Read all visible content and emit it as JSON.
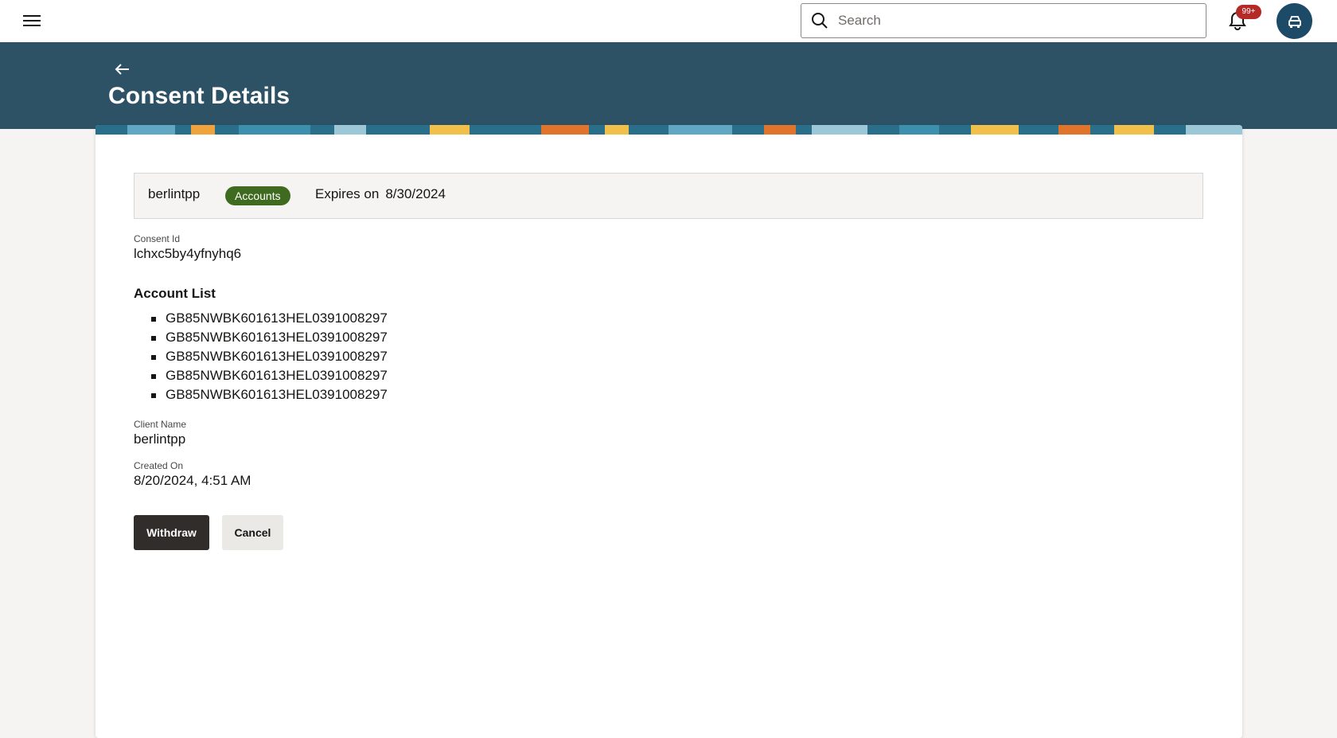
{
  "topbar": {
    "search_placeholder": "Search",
    "notification_count": "99+"
  },
  "header": {
    "title": "Consent Details"
  },
  "summary": {
    "client": "berlintpp",
    "type_badge": "Accounts",
    "expires_label": "Expires on",
    "expires_date": "8/30/2024"
  },
  "details": {
    "consent_id_label": "Consent Id",
    "consent_id_value": "lchxc5by4yfnyhq6",
    "account_list_title": "Account List",
    "accounts": [
      "GB85NWBK601613HEL0391008297",
      "GB85NWBK601613HEL0391008297",
      "GB85NWBK601613HEL0391008297",
      "GB85NWBK601613HEL0391008297",
      "GB85NWBK601613HEL0391008297"
    ],
    "client_name_label": "Client Name",
    "client_name_value": "berlintpp",
    "created_on_label": "Created On",
    "created_on_value": "8/20/2024, 4:51 AM"
  },
  "actions": {
    "withdraw_label": "Withdraw",
    "cancel_label": "Cancel"
  },
  "colors": {
    "header_band": "#2d5266",
    "avatar": "#1d4a66",
    "badge_green": "#3e6b1f",
    "notif_red": "#b52a26",
    "primary_button": "#312d2a"
  },
  "icons": {
    "menu": "hamburger-menu-icon",
    "search": "search-icon",
    "notifications": "bell-icon",
    "user": "user-avatar-icon",
    "back": "back-arrow-icon"
  }
}
